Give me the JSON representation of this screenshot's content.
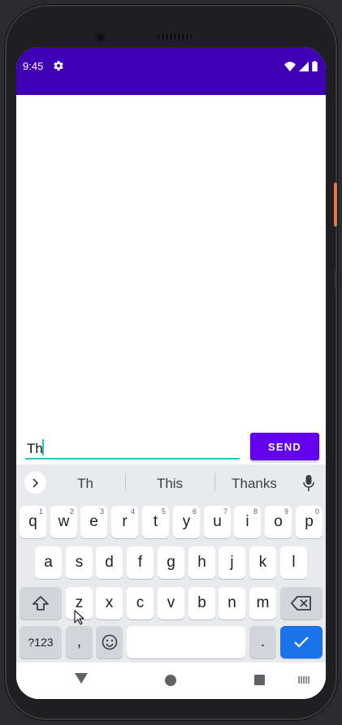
{
  "status_bar": {
    "time": "9:45",
    "bg_color": "#3f00b5",
    "icons": [
      "gear-icon",
      "wifi-icon",
      "cellular-signal-icon",
      "battery-icon"
    ]
  },
  "composer": {
    "input_value": "Th",
    "send_label": "SEND",
    "accent_color": "#1fc8c0",
    "button_color": "#6200ee"
  },
  "keyboard": {
    "suggestions": [
      "Th",
      "This",
      "Thanks"
    ],
    "row1": [
      {
        "key": "q",
        "hint": "1"
      },
      {
        "key": "w",
        "hint": "2"
      },
      {
        "key": "e",
        "hint": "3"
      },
      {
        "key": "r",
        "hint": "4"
      },
      {
        "key": "t",
        "hint": "5"
      },
      {
        "key": "y",
        "hint": "6"
      },
      {
        "key": "u",
        "hint": "7"
      },
      {
        "key": "i",
        "hint": "8"
      },
      {
        "key": "o",
        "hint": "9"
      },
      {
        "key": "p",
        "hint": "0"
      }
    ],
    "row2": [
      "a",
      "s",
      "d",
      "f",
      "g",
      "h",
      "j",
      "k",
      "l"
    ],
    "row3": [
      "z",
      "x",
      "c",
      "v",
      "b",
      "n",
      "m"
    ],
    "symbols_label": "?123",
    "comma_label": ",",
    "period_label": ".",
    "enter_color": "#1a73e8"
  },
  "navigation_bar": {
    "icons": [
      "back-icon",
      "home-icon",
      "recents-icon",
      "keyboard-switch-icon"
    ]
  }
}
